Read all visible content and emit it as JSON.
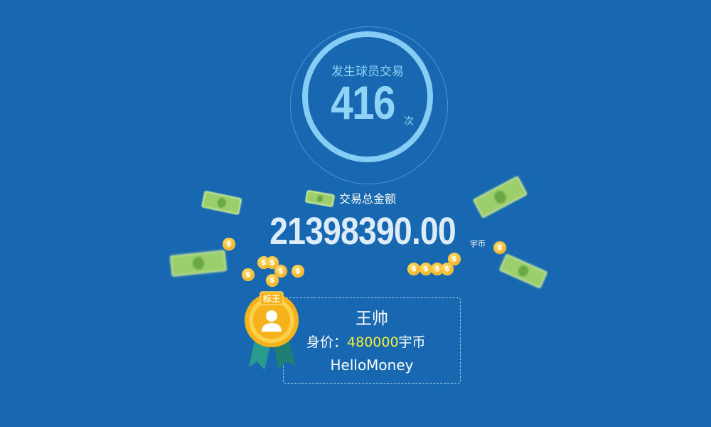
{
  "trade_count": {
    "title": "发生球员交易",
    "value": "416",
    "unit": "次"
  },
  "total": {
    "label": "交易总金额",
    "value": "21398390.00",
    "unit": "宇币"
  },
  "top_player": {
    "badge_text": "标王",
    "name": "王帅",
    "value_label": "身价：",
    "value_amount": "480000",
    "value_unit": "宇币",
    "team": "HelloMoney"
  },
  "decor": {
    "coin_symbol": "$"
  },
  "colors": {
    "background": "#1768b0",
    "ring": "#86cdf5",
    "highlight": "#f5ef3a",
    "medal_gold": "#f5b21b",
    "ribbon_teal": "#2a9a8e"
  }
}
